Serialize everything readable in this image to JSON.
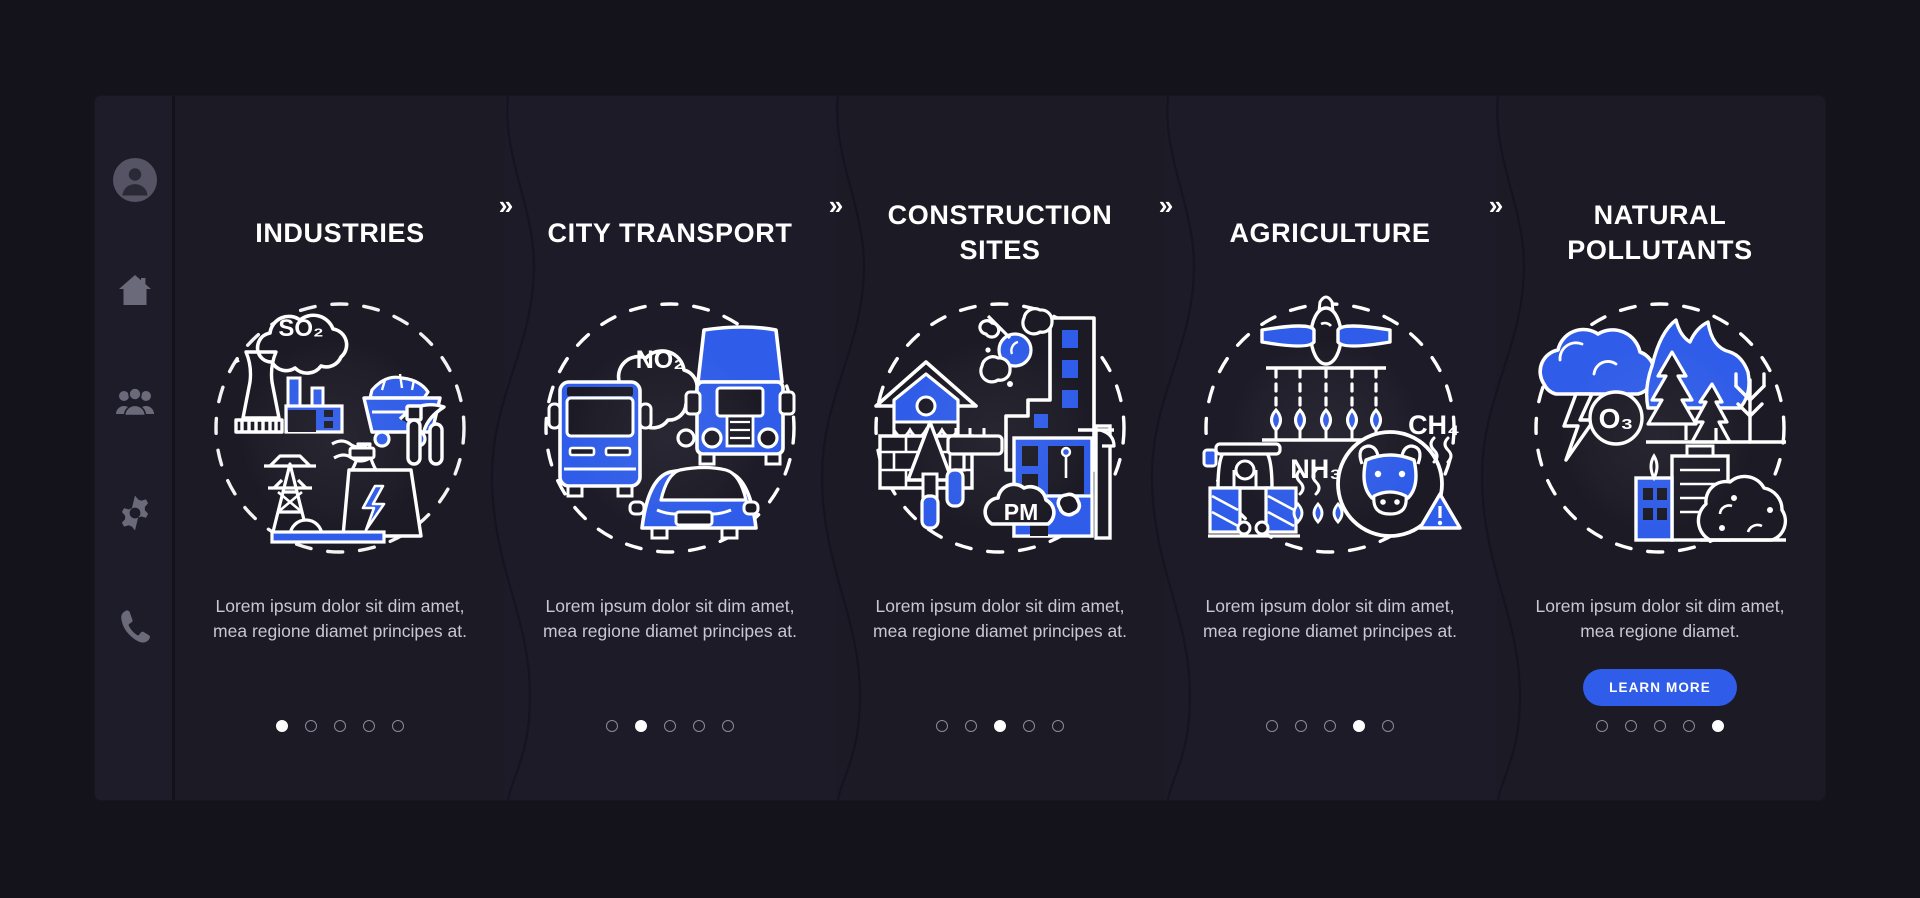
{
  "theme": {
    "page_bg": "#14131c",
    "card_bg": "#1b1a25",
    "sidebar_bg": "#1d1c28",
    "accent": "#2f5ce8",
    "title_color": "#ffffff",
    "body_color": "#c9c8d2",
    "icon_color": "#6b6a7b"
  },
  "sidebar": {
    "items": [
      {
        "icon": "user-avatar-icon",
        "label": "Profile"
      },
      {
        "icon": "home-icon",
        "label": "Home"
      },
      {
        "icon": "people-group-icon",
        "label": "Community"
      },
      {
        "icon": "gear-icon",
        "label": "Settings"
      },
      {
        "icon": "phone-icon",
        "label": "Contact"
      }
    ]
  },
  "separator": {
    "glyph": "»",
    "name": "chevron-double-right-icon"
  },
  "common": {
    "description": "Lorem ipsum dolor sit dim amet, mea regione diamet principes at.",
    "description_last": "Lorem ipsum dolor sit dim amet, mea regione diamet.",
    "learn_more_label": "LEARN MORE",
    "dot_count": 5
  },
  "panels": [
    {
      "index": 1,
      "title": "INDUSTRIES",
      "description": "Lorem ipsum dolor sit dim amet, mea regione diamet principes at.",
      "illustration": "industries-illustration",
      "illustration_labels": [
        "SO₂"
      ],
      "illustration_parts": [
        "smoke-cloud",
        "cooling-tower",
        "factory",
        "mining-cart",
        "pickaxe",
        "power-pylon",
        "power-plant-lightning"
      ],
      "active_dot": 1,
      "has_button": false
    },
    {
      "index": 2,
      "title": "CITY TRANSPORT",
      "description": "Lorem ipsum dolor sit dim amet, mea regione diamet principes at.",
      "illustration": "city-transport-illustration",
      "illustration_labels": [
        "NO₂"
      ],
      "illustration_parts": [
        "bus",
        "truck",
        "car",
        "exhaust-cloud"
      ],
      "active_dot": 2,
      "has_button": false
    },
    {
      "index": 3,
      "title": "CONSTRUCTION SITES",
      "description": "Lorem ipsum dolor sit dim amet, mea regione diamet principes at.",
      "illustration": "construction-sites-illustration",
      "illustration_labels": [
        "PM"
      ],
      "illustration_parts": [
        "house-painting",
        "trowel",
        "paint-roller",
        "office-building",
        "crane",
        "dust-cloud"
      ],
      "active_dot": 3,
      "has_button": false
    },
    {
      "index": 4,
      "title": "AGRICULTURE",
      "description": "Lorem ipsum dolor sit dim amet, mea regione diamet principes at.",
      "illustration": "agriculture-illustration",
      "illustration_labels": [
        "NH₃",
        "CH₄"
      ],
      "illustration_parts": [
        "crop-duster-plane",
        "crops",
        "tractor",
        "cow",
        "warning-triangle"
      ],
      "active_dot": 4,
      "has_button": false
    },
    {
      "index": 5,
      "title": "NATURAL POLLUTANTS",
      "description": "Lorem ipsum dolor sit dim amet, mea regione diamet.",
      "illustration": "natural-pollutants-illustration",
      "illustration_labels": [
        "O₃"
      ],
      "illustration_parts": [
        "storm-cloud-lightning",
        "forest-fire",
        "city-smog"
      ],
      "active_dot": 5,
      "has_button": true,
      "button_label": "LEARN MORE"
    }
  ]
}
